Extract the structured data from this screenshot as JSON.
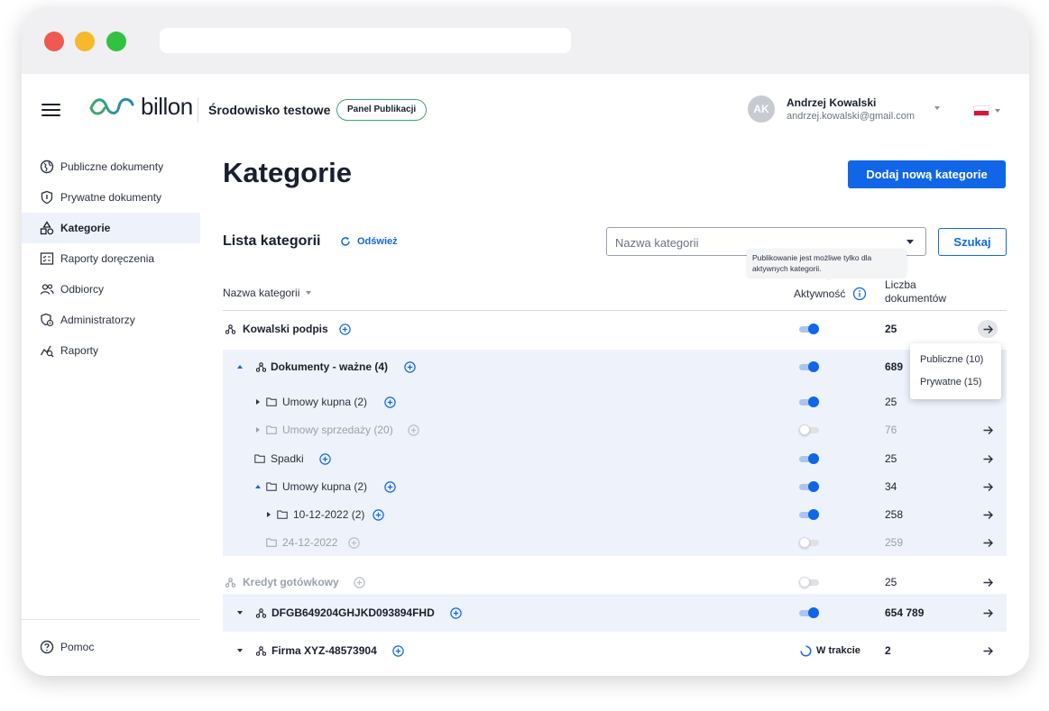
{
  "header": {
    "brand": "billon",
    "environment": "Środowisko testowe",
    "panel_badge": "Panel Publikacji",
    "user": {
      "initials": "AK",
      "name": "Andrzej Kowalski",
      "email": "andrzej.kowalski@gmail.com"
    },
    "language_flag": "PL"
  },
  "sidebar": {
    "items": [
      {
        "label": "Publiczne dokumenty",
        "icon": "globe-icon",
        "active": false
      },
      {
        "label": "Prywatne dokumenty",
        "icon": "shield-icon",
        "active": false
      },
      {
        "label": "Kategorie",
        "icon": "shapes-icon",
        "active": true
      },
      {
        "label": "Raporty doręczenia",
        "icon": "report-checklist-icon",
        "active": false
      },
      {
        "label": "Odbiorcy",
        "icon": "users-icon",
        "active": false
      },
      {
        "label": "Administratorzy",
        "icon": "admin-shield-icon",
        "active": false
      },
      {
        "label": "Raporty",
        "icon": "chart-search-icon",
        "active": false
      }
    ],
    "help": "Pomoc"
  },
  "main": {
    "title": "Kategorie",
    "add_button": "Dodaj nową kategorie",
    "list_title": "Lista kategorii",
    "refresh": "Odśwież",
    "search_placeholder": "Nazwa kategorii",
    "search_button": "Szukaj",
    "tooltip": "Publikowanie jest możliwe tylko dla aktywnych kategorii.",
    "columns": {
      "name": "Nazwa kategorii",
      "active": "Aktywność",
      "count_line1": "Liczba",
      "count_line2": "dokumentów"
    },
    "rows": [
      {
        "name": "Kowalski podpis",
        "count": "25",
        "active": true
      },
      {
        "name": "Dokumenty - ważne (4)",
        "count": "689",
        "active": true
      },
      {
        "name": "Umowy kupna (2)",
        "count": "25",
        "active": true
      },
      {
        "name": "Umowy sprzedaży (20)",
        "count": "76",
        "active": false
      },
      {
        "name": "Spadki",
        "count": "25",
        "active": true
      },
      {
        "name": "Umowy kupna (2)",
        "count": "34",
        "active": true
      },
      {
        "name": "10-12-2022 (2)",
        "count": "258",
        "active": true
      },
      {
        "name": "24-12-2022",
        "count": "259",
        "active": false
      },
      {
        "name": "Kredyt gotówkowy",
        "count": "25",
        "active": false
      },
      {
        "name": "DFGB649204GHJKD093894FHD",
        "count": "654 789",
        "active": true
      },
      {
        "name": "Firma XYZ-48573904",
        "count": "2",
        "status": "W trakcie"
      }
    ],
    "dropdown": [
      "Publiczne (10)",
      "Prywatne (15)"
    ]
  },
  "colors": {
    "primary": "#1166e8",
    "accent_green": "#3fa86a",
    "row_highlight": "#edf2fb"
  }
}
